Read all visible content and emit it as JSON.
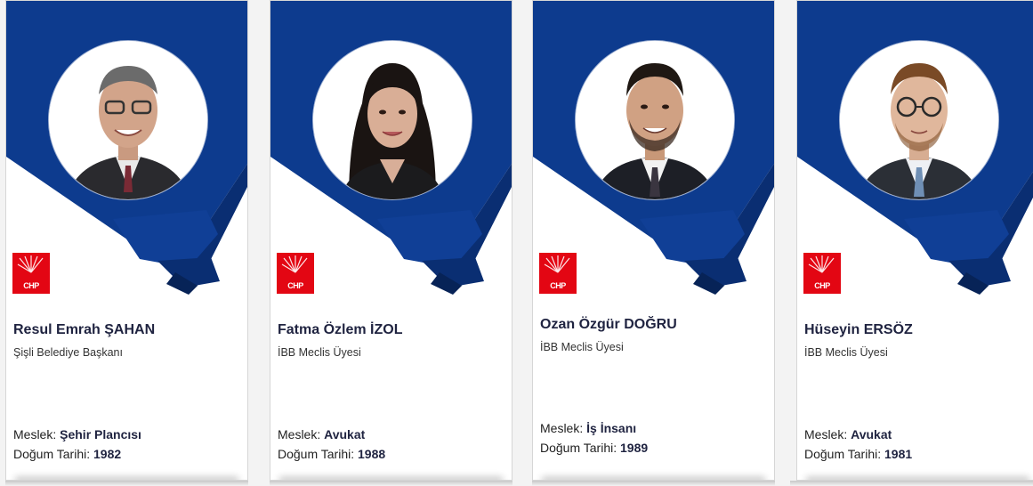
{
  "colors": {
    "navy": "#0d3b8e",
    "dark_navy": "#0a2e72",
    "party_red": "#e30613"
  },
  "cards": [
    {
      "name": "Resul Emrah ŞAHAN",
      "title": "Şişli Belediye Başkanı",
      "meslek_label": "Meslek:",
      "meslek": "Şehir Plancısı",
      "dogum_label": "Doğum Tarihi:",
      "dogum": "1982",
      "logo_text": "CHP",
      "photo": "portrait-bald-glasses-smiling"
    },
    {
      "name": "Fatma Özlem İZOL",
      "title": "İBB Meclis Üyesi",
      "meslek_label": "Meslek:",
      "meslek": "Avukat",
      "dogum_label": "Doğum Tarihi:",
      "dogum": "1988",
      "logo_text": "CHP",
      "photo": "portrait-woman-long-dark-hair"
    },
    {
      "name": "Ozan Özgür DOĞRU",
      "title": "İBB Meclis Üyesi",
      "meslek_label": "Meslek:",
      "meslek": "İş İnsanı",
      "dogum_label": "Doğum Tarihi:",
      "dogum": "1989",
      "logo_text": "CHP",
      "photo": "portrait-man-beard"
    },
    {
      "name": "Hüseyin ERSÖZ",
      "title": "İBB Meclis Üyesi",
      "meslek_label": "Meslek:",
      "meslek": "Avukat",
      "dogum_label": "Doğum Tarihi:",
      "dogum": "1981",
      "logo_text": "CHP",
      "photo": "portrait-man-glasses-beard"
    }
  ]
}
